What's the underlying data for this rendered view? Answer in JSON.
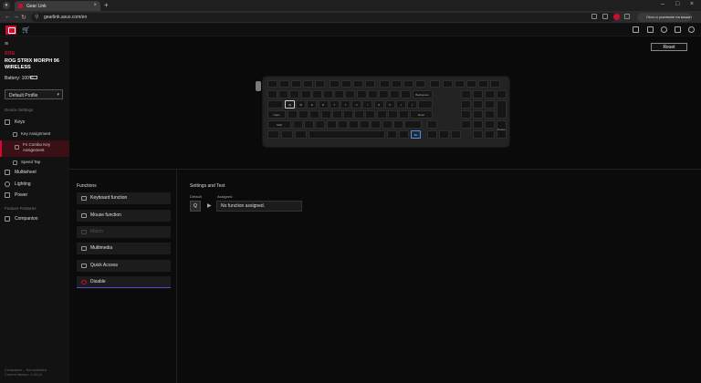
{
  "browser": {
    "tab_title": "Gear Link",
    "url": "gearlink.asus.com/en",
    "update_text": "Лъчо и усилване на машите"
  },
  "sidebar": {
    "brand": "ROG",
    "device_name": "ROG STRIX MORPH 96 WIRELESS",
    "battery": "Battery: 100%",
    "profile": "Default Profile",
    "section_device": "Device Settings",
    "keys": "Keys",
    "key_assignment": "Key Assignment",
    "fn_combo": "Fn Combo Key Assignment",
    "speed_tap": "Speed Tap",
    "multiwheel": "Multiwheel",
    "lighting": "Lighting",
    "power": "Power",
    "section_features": "Feature Features",
    "companion": "Companion",
    "version_line1": "Companion – Not activated",
    "version_line2": "Current Version: 1.00.12"
  },
  "toolbar": {
    "reset": "Reset"
  },
  "keyboard": {
    "selected_key": "Q",
    "fn_key": "Fn",
    "labels": {
      "backspace": "Backspace",
      "enter": "Enter",
      "delete": "Delete",
      "caps": "Caps",
      "shift": "Shift"
    }
  },
  "functions": {
    "title": "Functions",
    "items": [
      "Keyboard function",
      "Mouse function",
      "Macro",
      "Multimedia",
      "Quick Access",
      "Disable"
    ]
  },
  "settings": {
    "title": "Settings and Test",
    "default_label": "Default",
    "assigned_label": "Assigned",
    "default_key": "Q",
    "assigned_value": "No function assigned."
  }
}
